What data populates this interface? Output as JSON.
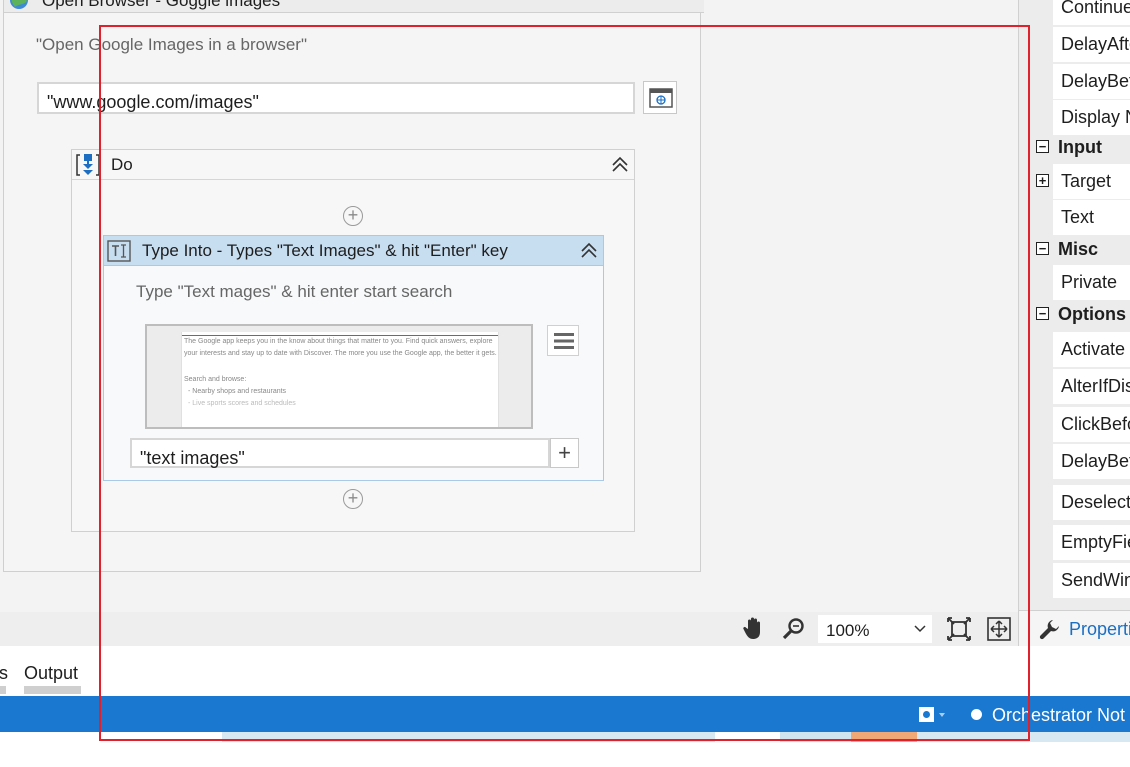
{
  "open_browser": {
    "title": "Open Browser - Goggle images",
    "annotation": "\"Open Google Images in a browser\"",
    "url_value": "\"www.google.com/images\""
  },
  "do_scope": {
    "title": "Do"
  },
  "type_into": {
    "title": "Type Into -  Types \"Text Images\" & hit \"Enter\" key",
    "annotation": "Type \"Text mages\" & hit enter start search",
    "text_value": "\"text images\"",
    "preview_lines": [
      "The Google app keeps you in the know about things that matter to you. Find quick answers, explore",
      "your interests and stay up to date with Discover. The more you use the Google app, the better it gets.",
      "Search and browse:",
      "- Nearby shops and restaurants",
      "- Live sports scores and schedules"
    ]
  },
  "toolbar": {
    "zoom": "100%"
  },
  "panel_tabs": {
    "partial_tab": "s",
    "output_tab": "Output"
  },
  "status_bar": {
    "orchestrator": "Orchestrator Not"
  },
  "properties": {
    "rows_top": [
      "Continue",
      "DelayAfter",
      "DelayBefore",
      "Display N"
    ],
    "category_input": "Input",
    "input_rows": [
      "Target",
      "Text"
    ],
    "category_misc": "Misc",
    "misc_rows": [
      "Private"
    ],
    "category_options": "Options",
    "options_rows": [
      "Activate",
      "AlterIfDisabled",
      "ClickBefore",
      "DelayBetween",
      "Deselect",
      "EmptyField",
      "SendWindowMessages"
    ],
    "tab_label": "Properties"
  },
  "colors": {
    "status_bar": "#1b78d0",
    "selection": "#c7ddf0",
    "annotation_box": "#e0202a",
    "link": "#1b6ec2"
  }
}
